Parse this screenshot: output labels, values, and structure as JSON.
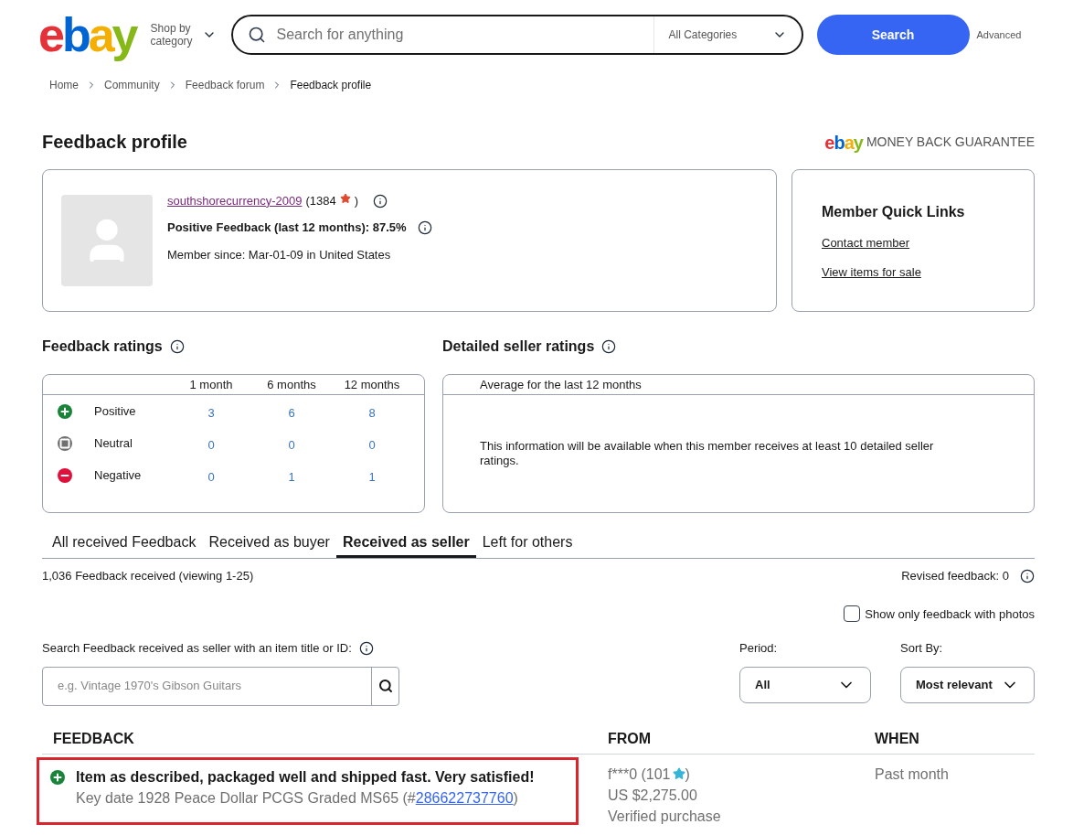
{
  "header": {
    "logo": "ebay",
    "shop_by": "Shop by category",
    "search": {
      "placeholder": "Search for anything",
      "category": "All Categories",
      "button": "Search"
    },
    "advanced": "Advanced"
  },
  "breadcrumbs": [
    "Home",
    "Community",
    "Feedback forum",
    "Feedback profile"
  ],
  "page_title": "Feedback profile",
  "guarantee": {
    "logo": "ebay",
    "text": "MONEY BACK GUARANTEE"
  },
  "profile": {
    "username": "southshorecurrency-2009",
    "score": "(1384",
    "score_close": ")",
    "positive": "Positive Feedback (last 12 months): 87.5%",
    "member_since": "Member since: Mar-01-09 in United States"
  },
  "quick_links": {
    "title": "Member Quick Links",
    "links": [
      "Contact member",
      "View items for sale"
    ]
  },
  "feedback_ratings": {
    "title": "Feedback ratings",
    "columns": [
      "1 month",
      "6 months",
      "12 months"
    ],
    "rows": [
      {
        "kind": "positive",
        "label": "Positive",
        "values": [
          "3",
          "6",
          "8"
        ]
      },
      {
        "kind": "neutral",
        "label": "Neutral",
        "values": [
          "0",
          "0",
          "0"
        ]
      },
      {
        "kind": "negative",
        "label": "Negative",
        "values": [
          "0",
          "1",
          "1"
        ]
      }
    ]
  },
  "detailed_ratings": {
    "title": "Detailed seller ratings",
    "subtitle": "Average for the last 12 months",
    "message": "This information will be available when this member receives at least 10 detailed seller ratings."
  },
  "tabs": [
    {
      "label": "All received Feedback",
      "selected": false
    },
    {
      "label": "Received as buyer",
      "selected": false
    },
    {
      "label": "Received as seller",
      "selected": true
    },
    {
      "label": "Left for others",
      "selected": false
    }
  ],
  "summary": "1,036 Feedback received (viewing 1-25)",
  "revised": "Revised feedback: 0",
  "photos_only": {
    "label": "Show only feedback with photos",
    "checked": false
  },
  "feedback_search": {
    "label": "Search Feedback received as seller with an item title or ID:",
    "placeholder": "e.g. Vintage 1970's Gibson Guitars"
  },
  "period": {
    "label": "Period:",
    "value": "All"
  },
  "sort": {
    "label": "Sort By:",
    "value": "Most relevant"
  },
  "table": {
    "columns": [
      "FEEDBACK",
      "FROM",
      "WHEN"
    ],
    "rows": [
      {
        "kind": "positive",
        "highlighted": true,
        "comment": "Item as described, packaged well and shipped fast. Very satisfied!",
        "item": "Key date 1928 Peace Dollar PCGS Graded MS65 (#",
        "item_id": "286622737760",
        "item_end": ")",
        "from": "f***0 (101",
        "from_end": ")",
        "price": "US $2,275.00",
        "verified": "Verified purchase",
        "when": "Past month"
      }
    ]
  }
}
